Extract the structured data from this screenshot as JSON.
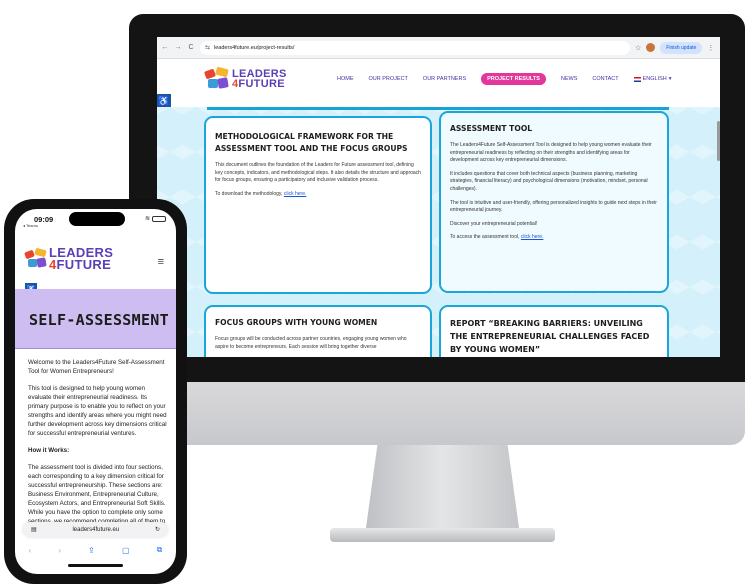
{
  "browser": {
    "back": "←",
    "forward": "→",
    "reload": "C",
    "url": "leaders4future.eu/project-results/",
    "finish_update": "Finish update"
  },
  "site": {
    "logo_line1": "LEADERS",
    "logo_line2_num": "4",
    "logo_line2_text": "FUTURE",
    "nav": [
      "HOME",
      "OUR PROJECT",
      "OUR PARTNERS",
      "PROJECT RESULTS",
      "NEWS",
      "CONTACT"
    ],
    "language": "ENGLISH",
    "brand_color": "#5b3fb4",
    "accent_color": "#e3379b",
    "card_border_color": "#1aa6d8"
  },
  "cards": [
    {
      "title": "METHODOLOGICAL FRAMEWORK FOR THE ASSESSMENT TOOL AND THE FOCUS GROUPS",
      "paragraphs": [
        "This document outlines the foundation of the Leaders for Future assessment tool, defining key concepts, indicators, and methodological steps. It also details the structure and approach for focus groups, ensuring a participatory and inclusive validation process."
      ],
      "link_prefix": "To download the methodology,",
      "link_text": "click here."
    },
    {
      "title": "ASSESSMENT TOOL",
      "paragraphs": [
        "The Leaders4Future Self-Assessment Tool is designed to help young women evaluate their entrepreneurial readiness by reflecting on their strengths and identifying areas for development across key entrepreneurial dimensions.",
        "It includes questions that cover both technical aspects (business planning, marketing strategies, financial literacy) and psychological dimensions (motivation, mindset, personal challenges).",
        "The tool is intuitive and user-friendly, offering personalized insights to guide next steps in their entrepreneurial journey.",
        "Discover your entrepreneurial potential!"
      ],
      "link_prefix": "To access the assessment tool,",
      "link_text": "click here."
    },
    {
      "title": "FOCUS GROUPS WITH YOUNG WOMEN",
      "paragraphs": [
        "Focus groups will be conducted across partner countries, engaging young women who aspire to become entrepreneurs. Each session will bring together diverse"
      ]
    },
    {
      "title": "REPORT “BREAKING BARRIERS: UNVEILING THE ENTREPRENEURIAL CHALLENGES FACED BY YOUNG WOMEN”",
      "paragraphs": []
    }
  ],
  "phone": {
    "time": "09:09",
    "back_app": "◂ Teams",
    "page_title": "SELF-ASSESSMENT",
    "paragraphs": [
      "Welcome to the Leaders4Future Self-Assessment Tool for Women Entrepreneurs!",
      "This tool is designed to help young women evaluate their entrepreneurial readiness. Its primary purpose is to enable you to reflect on your strengths and identify areas where you might need further development across key dimensions critical for successful entrepreneurial ventures."
    ],
    "how_heading": "How it Works:",
    "how_text": "The assessment tool is divided into four sections, each corresponding to a key dimension critical for successful entrepreneurship. These sections are: Business Environment, Entrepreneurial Culture, Ecosystem Actors, and Entrepreneurial Soft Skills. While you have the option to complete only some sections, we recommend completing all of them to",
    "url": "leaders4future.eu"
  }
}
